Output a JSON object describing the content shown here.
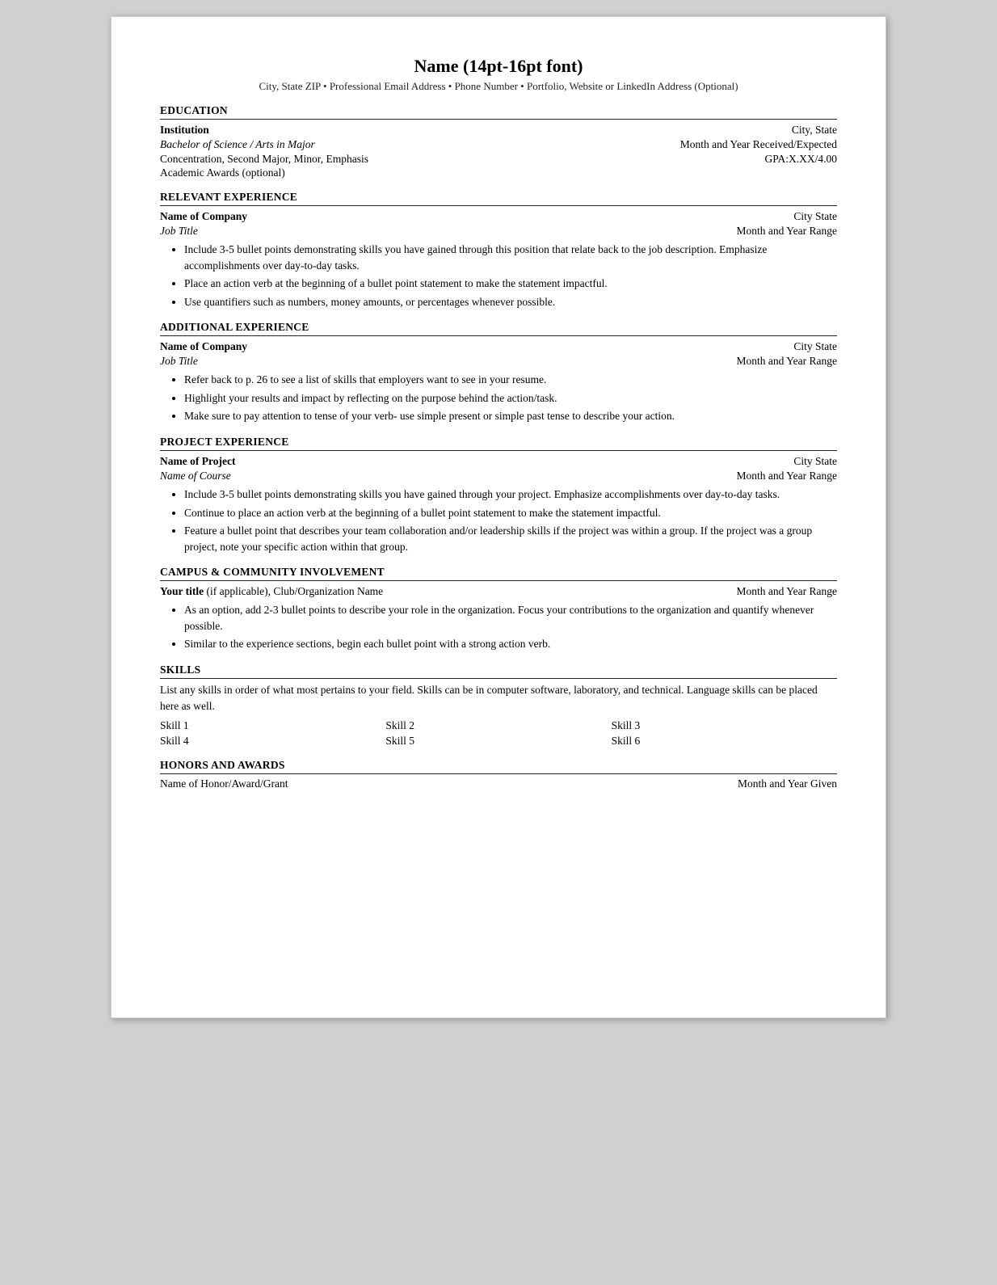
{
  "header": {
    "name": "Name (14pt-16pt font)",
    "contact": "City, State  ZIP  •  Professional Email Address  •  Phone Number  •  Portfolio, Website or LinkedIn Address (Optional)"
  },
  "sections": {
    "education": {
      "heading": "EDUCATION",
      "institution": "Institution",
      "city_state": "City, State",
      "degree": "Bachelor of Science / Arts in Major",
      "month_year": "Month and Year Received/Expected",
      "concentration": "Concentration, Second Major, Minor, Emphasis",
      "gpa": "GPA:X.XX/4.00",
      "awards": "Academic Awards (optional)"
    },
    "relevant_experience": {
      "heading": "RELEVANT EXPERIENCE",
      "company": "Name of Company",
      "city_state": "City State",
      "job_title": "Job Title",
      "month_year": "Month and Year Range",
      "bullets": [
        "Include 3-5 bullet points demonstrating skills you have gained through this position that relate back to the job description. Emphasize accomplishments over day-to-day tasks.",
        "Place an action verb at the beginning of a bullet point statement to make the statement impactful.",
        "Use quantifiers such as numbers, money amounts, or percentages whenever possible."
      ]
    },
    "additional_experience": {
      "heading": "ADDITIONAL EXPERIENCE",
      "company": "Name of Company",
      "city_state": "City State",
      "job_title": "Job Title",
      "month_year": "Month and Year Range",
      "bullets": [
        "Refer back to p. 26 to see a list of skills that employers want to see in your resume.",
        "Highlight your results and impact by reflecting on the purpose behind the action/task.",
        "Make sure to pay attention to tense of your verb- use simple present or simple past tense to describe your action."
      ]
    },
    "project_experience": {
      "heading": "PROJECT EXPERIENCE",
      "project_name": "Name of Project",
      "city_state": "City State",
      "course_name": "Name of Course",
      "month_year": "Month and Year Range",
      "bullets": [
        "Include 3-5 bullet points demonstrating skills you have gained through your project. Emphasize accomplishments over day-to-day tasks.",
        "Continue to place an action verb at the beginning of a bullet point statement to make the statement impactful.",
        "Feature a bullet point that describes your team collaboration and/or leadership skills if the project was within a group. If the project was a group project, note your specific action within that group."
      ]
    },
    "campus_involvement": {
      "heading": "CAMPUS & COMMUNITY INVOLVEMENT",
      "title_bold": "Your title",
      "title_rest": " (if applicable), Club/Organization Name",
      "month_year": "Month and Year Range",
      "bullets": [
        "As an option, add 2-3 bullet points to describe your role in the organization. Focus your contributions to the organization and quantify whenever possible.",
        "Similar to the experience sections, begin each bullet point with a strong action verb."
      ]
    },
    "skills": {
      "heading": "SKILLS",
      "description": "List any skills in order of what most pertains to your field.  Skills can be in computer software, laboratory, and technical. Language skills can be placed here as well.",
      "skills_list": [
        "Skill 1",
        "Skill 2",
        "Skill 3",
        "Skill 4",
        "Skill 5",
        "Skill 6"
      ]
    },
    "honors": {
      "heading": "HONORS AND AWARDS",
      "honor_name": "Name of Honor/Award/Grant",
      "month_year": "Month and Year Given"
    }
  }
}
